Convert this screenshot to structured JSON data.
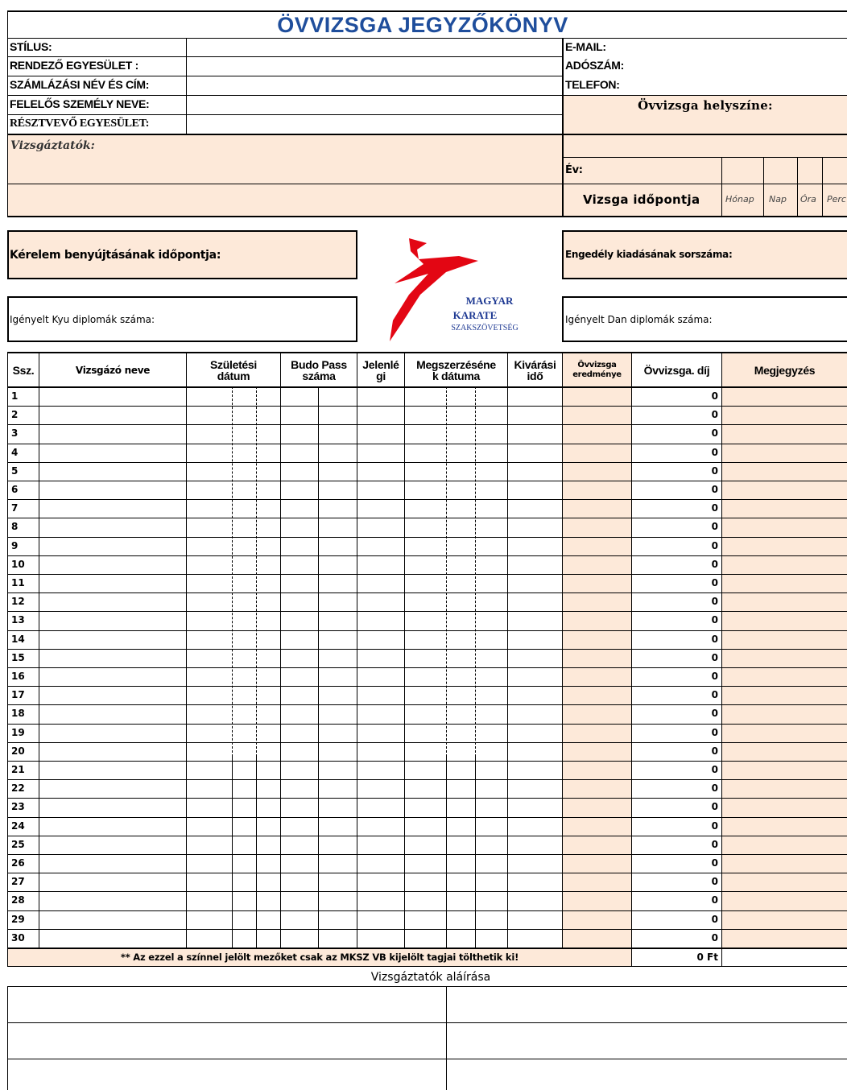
{
  "title": "ÖVVIZSGA JEGYZŐKÖNYV",
  "left_fields": [
    "STÍLUS:",
    "RENDEZŐ EGYESÜLET :",
    "SZÁMLÁZÁSI NÉV ÉS CÍM:",
    "FELELŐS SZEMÉLY NEVE:",
    "RÉSZTVEVŐ EGYESÜLET:"
  ],
  "right_fields": [
    "E-MAIL:",
    "ADÓSZÁM:",
    "TELEFON:"
  ],
  "location_label": "Övvizsga helyszíne:",
  "examiners_label": "Vizsgáztatók:",
  "year_label": "Év:",
  "exam_time_label": "Vizsga időpontja",
  "time_units": [
    "Hónap",
    "Nap",
    "Óra",
    "Perc"
  ],
  "request_label": "Kérelem benyújtásának időpontja:",
  "permit_label": "Engedély kiadásának sorszáma:",
  "kyu_label": "Igényelt Kyu diplomák száma:",
  "dan_label": "Igényelt Dan diplomák száma:",
  "logo": {
    "line1": "MAGYAR",
    "line2": "KARATE",
    "line3": "SZAKSZÖVETSÉG",
    "accent": "#e30613",
    "text_color": "#1f3a93"
  },
  "table": {
    "headers": {
      "ssz": "Ssz.",
      "name": "Vizsgázó neve",
      "birth": [
        "Születési",
        "dátum"
      ],
      "budo": [
        "Budo Pass",
        "száma"
      ],
      "present": [
        "Jelenlé",
        "gi"
      ],
      "acquired": [
        "Megszerzéséne",
        "k dátuma"
      ],
      "wait": [
        "Kivárási",
        "idő"
      ],
      "result": [
        "Övvizsga",
        "eredménye"
      ],
      "fee": "Övvizsga. díj",
      "note": "Megjegyzés"
    },
    "row_fee": "0",
    "footer_note": "** Az ezzel a színnel jelölt mezőket csak az MKSZ VB kijelölt tagjai tölthetik ki!",
    "total": "0 Ft"
  },
  "signature_label": "Vizsgáztatók aláírása",
  "colors": {
    "peach": "#fde9d9",
    "title_blue": "#1f4e9c"
  }
}
